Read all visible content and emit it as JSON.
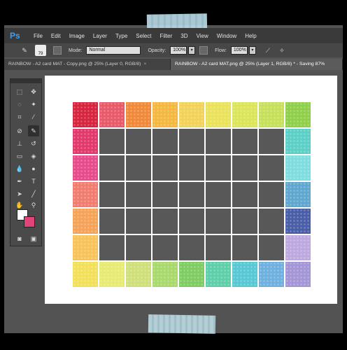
{
  "app": {
    "logo": "Ps"
  },
  "menu": [
    "File",
    "Edit",
    "Image",
    "Layer",
    "Type",
    "Select",
    "Filter",
    "3D",
    "View",
    "Window",
    "Help"
  ],
  "options": {
    "brush_size": "79",
    "mode_label": "Mode:",
    "mode_value": "Normal",
    "opacity_label": "Opacity:",
    "opacity_value": "100%",
    "flow_label": "Flow:",
    "flow_value": "100%"
  },
  "tabs": [
    {
      "label": "RAINBOW - A2 card MAT - Copy.png @ 25% (Layer 0, RGB/8)",
      "close": "×",
      "active": false
    },
    {
      "label": "RAINBOW - A2 card MAT.png @ 25% (Layer 1, RGB/8) * - Saving 87%",
      "close": "",
      "active": true
    }
  ],
  "colors": {
    "foreground": "#ffffff",
    "background": "#e0447a",
    "tile_gray": "#585858",
    "top_row": [
      "#d8253f",
      "#e85a6a",
      "#f08a3a",
      "#f4b740",
      "#f3d25a",
      "#e9e25a",
      "#dbe55a",
      "#c7e05a",
      "#8fcf4a"
    ],
    "bottom_row": [
      "#f2e05a",
      "#e7ea73",
      "#cfe07a",
      "#a9d86c",
      "#7fcc62",
      "#5ecfa8",
      "#58c9d4",
      "#6fb0df",
      "#a496d6"
    ],
    "left_col": [
      "#e2396c",
      "#e74b8b",
      "#f17d70",
      "#f6a35a",
      "#f7c35a"
    ],
    "right_col": [
      "#5ccfc6",
      "#7fdde0",
      "#5fa7cf",
      "#4a5ea8",
      "#bda8e0"
    ]
  }
}
